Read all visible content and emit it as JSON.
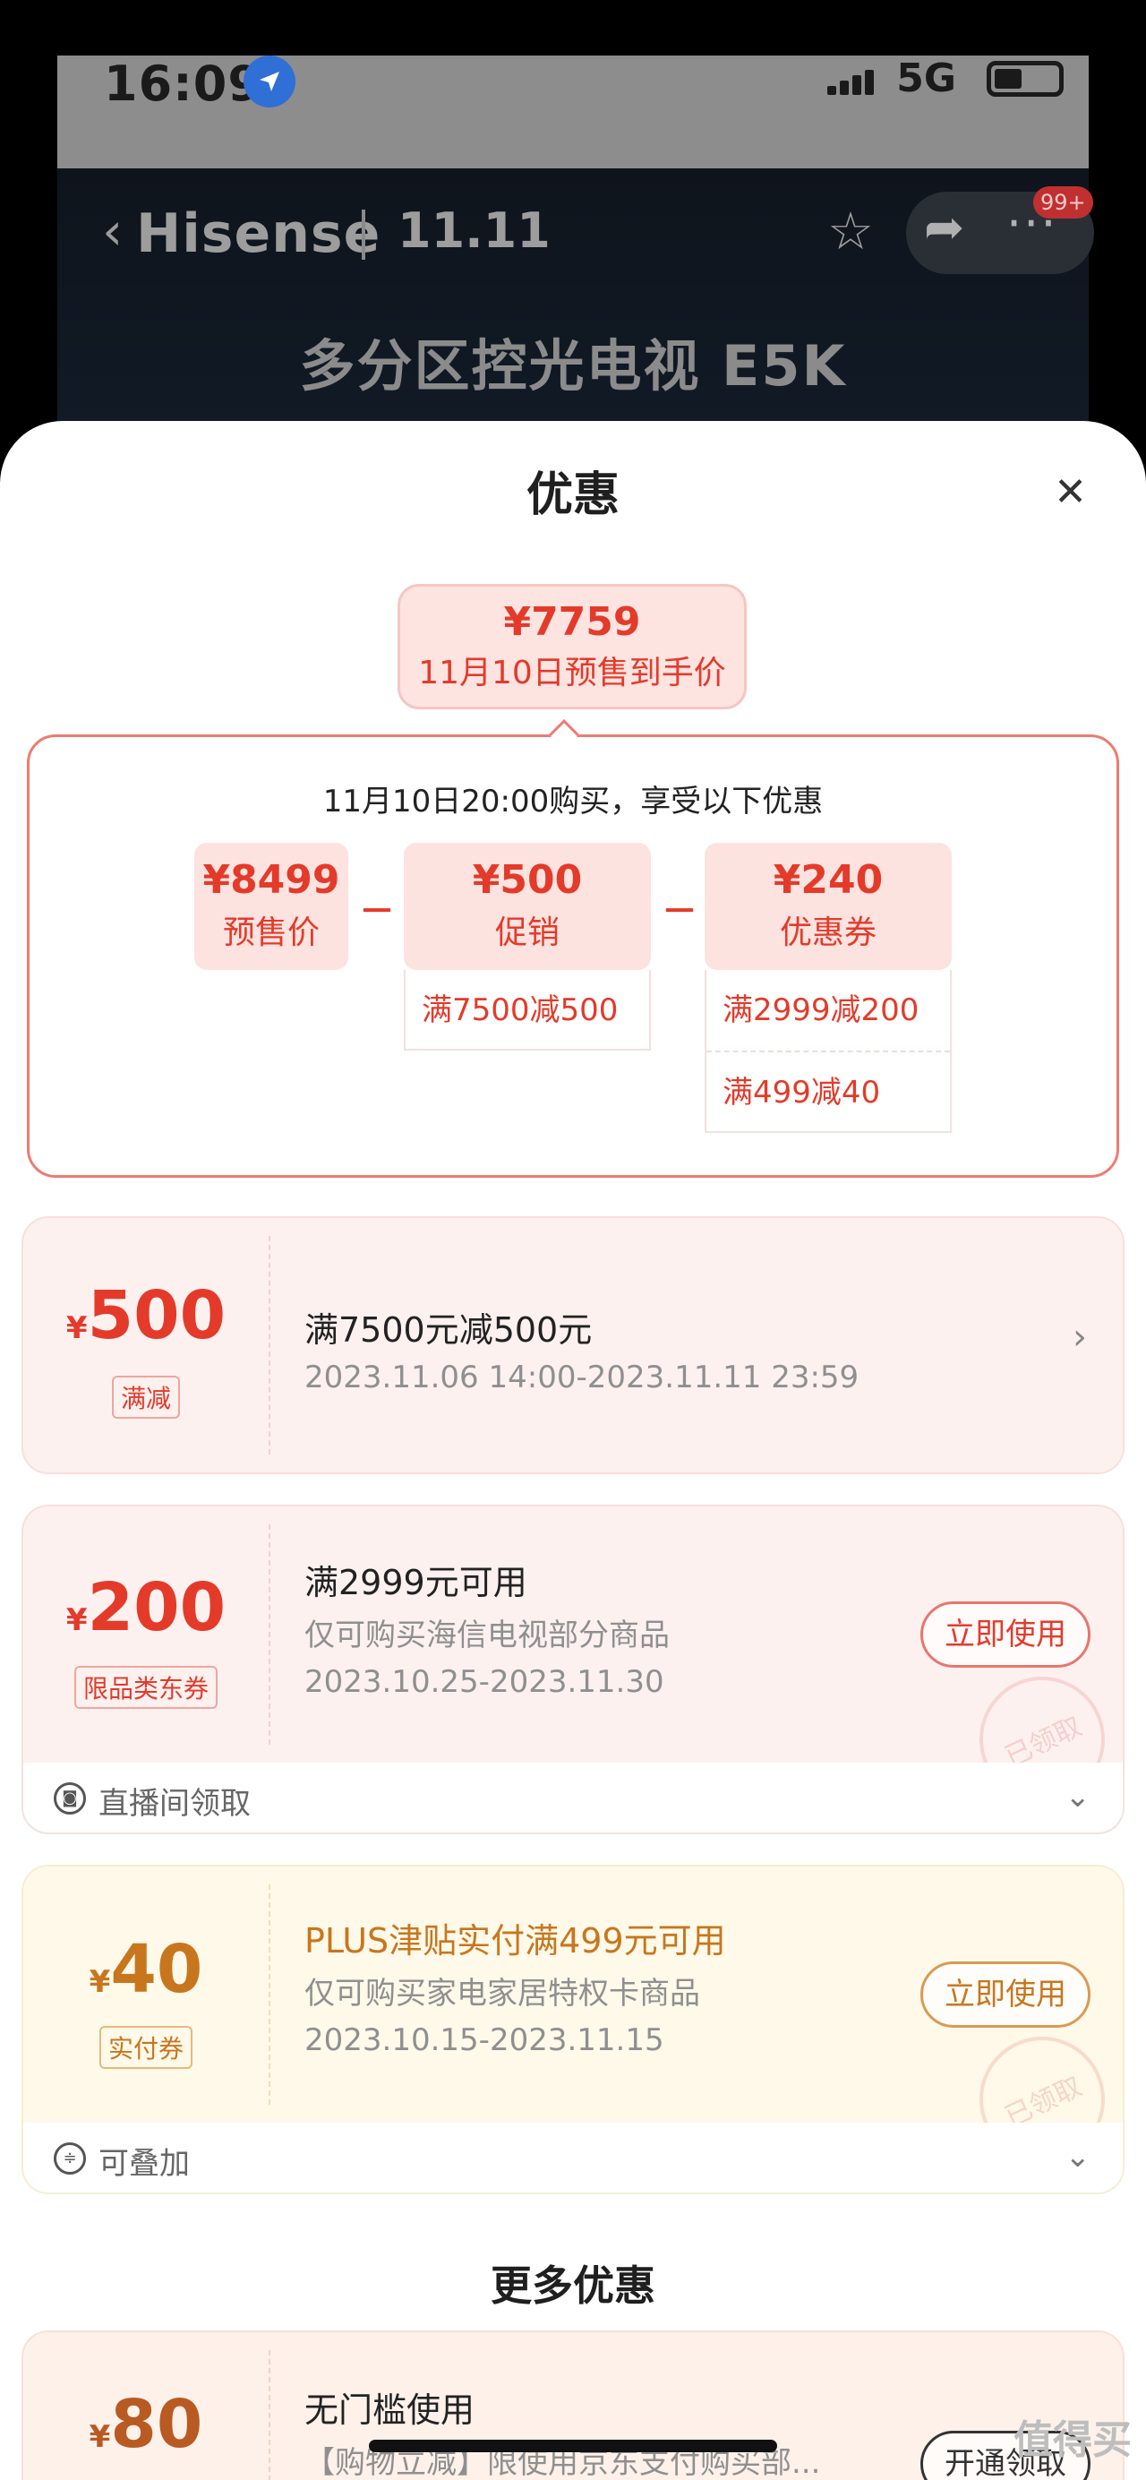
{
  "status_bar": {
    "time": "16:09",
    "network": "5G"
  },
  "product_header": {
    "brand": "Hisense",
    "event_logo": "11.11",
    "notification_badge": "99+",
    "product_title": "多分区控光电视 E5K"
  },
  "sheet": {
    "title": "优惠",
    "summary": {
      "price": "¥7759",
      "label": "11月10日预售到手价",
      "description": "11月10日20:00购买，享受以下优惠",
      "items": [
        {
          "value": "¥8499",
          "label": "预售价",
          "details": []
        },
        {
          "value": "¥500",
          "label": "促销",
          "details": [
            "满7500减500"
          ]
        },
        {
          "value": "¥240",
          "label": "优惠券",
          "details": [
            "满2999减200",
            "满499减40"
          ]
        }
      ],
      "operator": "－"
    },
    "coupons": [
      {
        "currency": "¥",
        "amount": "500",
        "badge": "满减",
        "title": "满7500元减500元",
        "lines": [
          "2023.11.06 14:00-2023.11.11 23:59"
        ]
      },
      {
        "currency": "¥",
        "amount": "200",
        "badge": "限品类东券",
        "title": "满2999元可用",
        "lines": [
          "仅可购买海信电视部分商品",
          "2023.10.25-2023.11.30"
        ],
        "button": "立即使用",
        "stamp": "已领取",
        "footer": "直播间领取"
      },
      {
        "currency": "¥",
        "amount": "40",
        "badge": "实付券",
        "title": "PLUS津贴实付满499元可用",
        "lines": [
          "仅可购买家电家居特权卡商品",
          "2023.10.15-2023.11.15"
        ],
        "button": "立即使用",
        "stamp": "已领取",
        "footer": "可叠加"
      },
      {
        "currency": "¥",
        "amount": "80",
        "title": "无门槛使用",
        "lines": [
          "【购物立减】限使用京东支付购买部..."
        ],
        "button": "开通领取"
      }
    ],
    "more_title": "更多优惠"
  },
  "watermark": "值得买",
  "colors": {
    "accent_red": "#e43a2a",
    "coupon_pink_bg": "#fdf1f0",
    "coupon_yellow_bg": "#fef9e9",
    "plus_gold": "#c8761e"
  }
}
